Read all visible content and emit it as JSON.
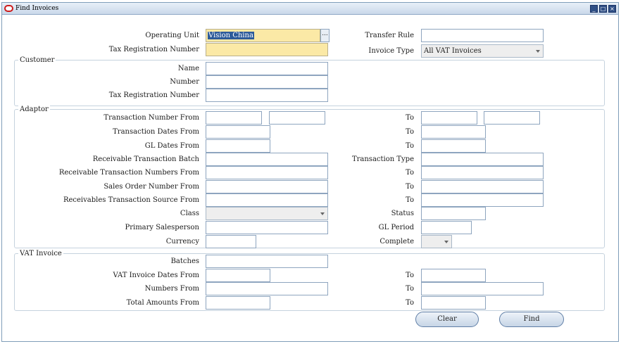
{
  "window": {
    "title": "Find Invoices",
    "controls": [
      "minimize-icon",
      "maximize-icon",
      "close-icon"
    ]
  },
  "top": {
    "operating_unit_label": "Operating Unit",
    "operating_unit_value": "Vision China",
    "lov_glyph": "...",
    "tax_reg_label": "Tax Registration Number",
    "transfer_rule_label": "Transfer Rule",
    "invoice_type_label": "Invoice Type",
    "invoice_type_value": "All VAT Invoices"
  },
  "customer": {
    "title": "Customer",
    "name_label": "Name",
    "number_label": "Number",
    "tax_reg_label": "Tax Registration Number"
  },
  "adaptor": {
    "title": "Adaptor",
    "trx_number_from": "Transaction Number From",
    "trx_dates_from": "Transaction Dates From",
    "gl_dates_from": "GL Dates From",
    "receivable_batch": "Receivable Transaction Batch",
    "receivable_numbers_from": "Receivable Transaction Numbers From",
    "sales_order_from": "Sales Order Number From",
    "source_from": "Receivables Transaction Source From",
    "class": "Class",
    "primary_salesperson": "Primary Salesperson",
    "currency": "Currency",
    "to": "To",
    "transaction_type": "Transaction Type",
    "status": "Status",
    "gl_period": "GL Period",
    "complete": "Complete"
  },
  "vat_invoice": {
    "title": "VAT Invoice",
    "batches": "Batches",
    "dates_from": "VAT Invoice Dates From",
    "numbers_from": "Numbers From",
    "amounts_from": "Total Amounts From",
    "to": "To"
  },
  "buttons": {
    "clear": "Clear",
    "find": "Find"
  },
  "colors": {
    "required_field": "#fbe9a6",
    "selection": "#2d5b9a",
    "border": "#8ea5bf"
  }
}
